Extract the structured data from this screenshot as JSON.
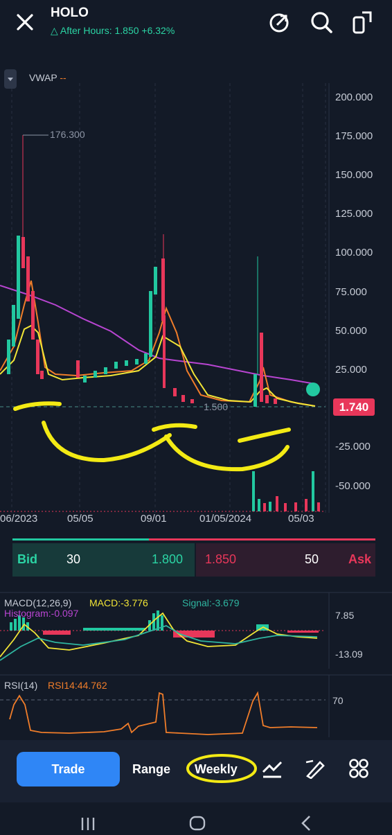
{
  "header": {
    "symbol": "HOLO",
    "after_hours": "After Hours: 1.850 +6.32%"
  },
  "indicator_toggle": {
    "label": "VWAP",
    "value": "--"
  },
  "price_axis": [
    "200.000",
    "175.000",
    "150.000",
    "125.000",
    "100.000",
    "75.000",
    "50.000",
    "25.000",
    "-25.000",
    "-50.000"
  ],
  "date_axis": [
    "06/2023",
    "05/05",
    "09/01",
    "01/05/2024",
    "05/03"
  ],
  "annotations": {
    "high_label": "176.300",
    "low_label": "1.500",
    "last_price": "1.740"
  },
  "quote": {
    "bid_label": "Bid",
    "bid_size": "30",
    "bid_price": "1.800",
    "ask_price": "1.850",
    "ask_size": "50",
    "ask_label": "Ask"
  },
  "macd": {
    "title": "MACD(12,26,9)",
    "macd": "MACD:-3.776",
    "signal": "Signal:-3.679",
    "histogram": "Histogram:-0.097",
    "axis_top": "7.85",
    "axis_bottom": "-13.09"
  },
  "rsi": {
    "title": "RSI(14)",
    "value": "RSI14:44.762",
    "level": "70"
  },
  "toolbar": {
    "trade": "Trade",
    "range": "Range",
    "period": "Weekly"
  },
  "colors": {
    "up": "#22c8a0",
    "down": "#e8375a",
    "bg": "#131a27",
    "trade_btn": "#2f86f6",
    "highlight": "#f3ea14"
  },
  "chart_data": {
    "type": "candlestick",
    "x": [
      "06/2023",
      "05/05",
      "09/01",
      "01/05/2024",
      "05/03"
    ],
    "ylim": [
      -60,
      210
    ],
    "high": 176.3,
    "low": 1.5,
    "last": 1.74,
    "series": [
      {
        "name": "VWAP",
        "values": [
          78,
          58,
          40,
          28,
          22,
          18
        ]
      }
    ]
  }
}
